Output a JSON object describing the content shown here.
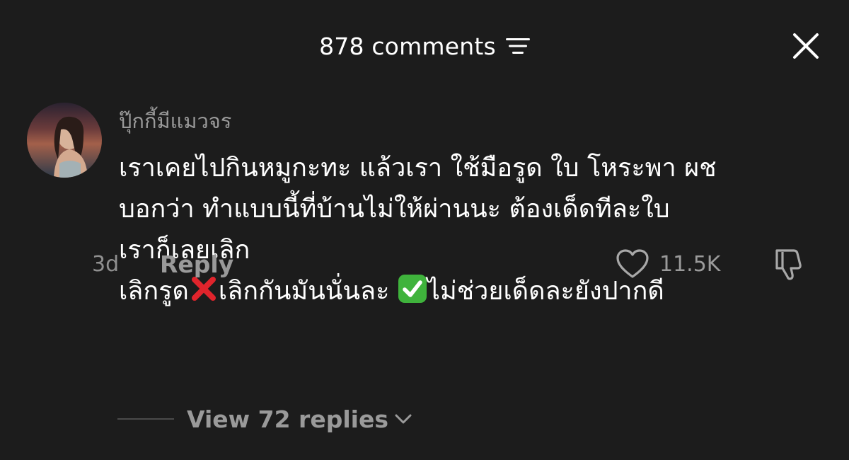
{
  "header": {
    "comments_count": "878 comments",
    "sort_icon": "sort-icon",
    "close_icon": "close-icon"
  },
  "comment": {
    "username": "ปุ๊กกี้มีแมวจร",
    "lines": [
      "เราเคยไปกินหมูกะทะ แล้วเรา ใช้มือรูด ใบ โหระพา ผช",
      "บอกว่า ทำแบบนี้ที่บ้านไม่ให้ผ่านนะ ต้องเด็ดทีละใบ",
      "เราก็เลยเลิก"
    ],
    "last_line": {
      "part1": "เลิกรูด",
      "part2": "เลิกกันมันนั่นละ ",
      "part3": "ไม่ช่วยเด็ดละยังปากดี"
    },
    "timestamp": "3d",
    "reply_label": "Reply",
    "like_count": "11.5K",
    "replies_label": "View 72 replies"
  },
  "colors": {
    "background": "#1c1c1c",
    "primary_text": "#ffffff",
    "secondary_text": "#9a9a9a",
    "cross_mark": "#e0242c",
    "check_mark": "#3fb33c"
  }
}
